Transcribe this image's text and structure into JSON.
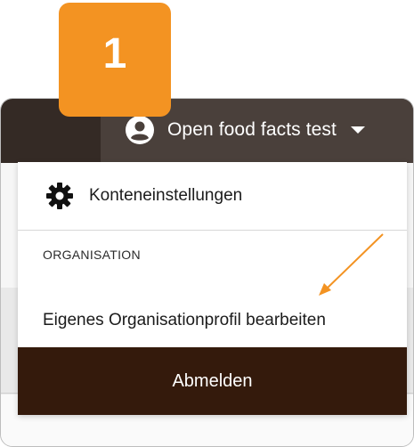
{
  "step_badge": {
    "number": "1"
  },
  "header": {
    "user_name": "Open food facts test",
    "user_icon": "user-circle-icon",
    "caret_icon": "caret-down-icon"
  },
  "menu": {
    "settings_label": "Konteneinstellungen",
    "settings_icon": "gear-icon",
    "section_label": "ORGANISATION",
    "org_profile_label": "Eigenes Organisationprofil bearbeiten",
    "logout_label": "Abmelden"
  },
  "colors": {
    "badge": "#f39322",
    "topbar": "#342a25",
    "topbar_user": "#4a403b",
    "logout_bg": "#341a0c",
    "arrow": "#f39322"
  }
}
